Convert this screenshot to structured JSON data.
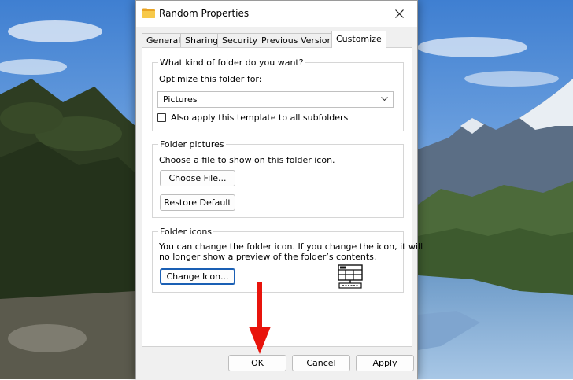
{
  "window": {
    "title": "Random Properties",
    "icon": "folder-icon"
  },
  "tabs": [
    {
      "label": "General",
      "active": false
    },
    {
      "label": "Sharing",
      "active": false
    },
    {
      "label": "Security",
      "active": false
    },
    {
      "label": "Previous Versions",
      "active": false
    },
    {
      "label": "Customize",
      "active": true
    }
  ],
  "folder_type": {
    "heading": "What kind of folder do you want?",
    "optimize_label": "Optimize this folder for:",
    "selected_option": "Pictures",
    "apply_subfolders_label": "Also apply this template to all subfolders",
    "apply_subfolders_checked": false
  },
  "folder_pictures": {
    "heading": "Folder pictures",
    "description": "Choose a file to show on this folder icon.",
    "choose_file_label": "Choose File...",
    "restore_default_label": "Restore Default"
  },
  "folder_icons": {
    "heading": "Folder icons",
    "description_line1": "You can change the folder icon. If you change the icon, it will",
    "description_line2": "no longer show a preview of the folder’s contents.",
    "change_icon_label": "Change Icon..."
  },
  "footer": {
    "ok_label": "OK",
    "cancel_label": "Cancel",
    "apply_label": "Apply"
  },
  "colors": {
    "annotation_arrow": "#e8140c",
    "focus_border": "#1a5fb4"
  }
}
